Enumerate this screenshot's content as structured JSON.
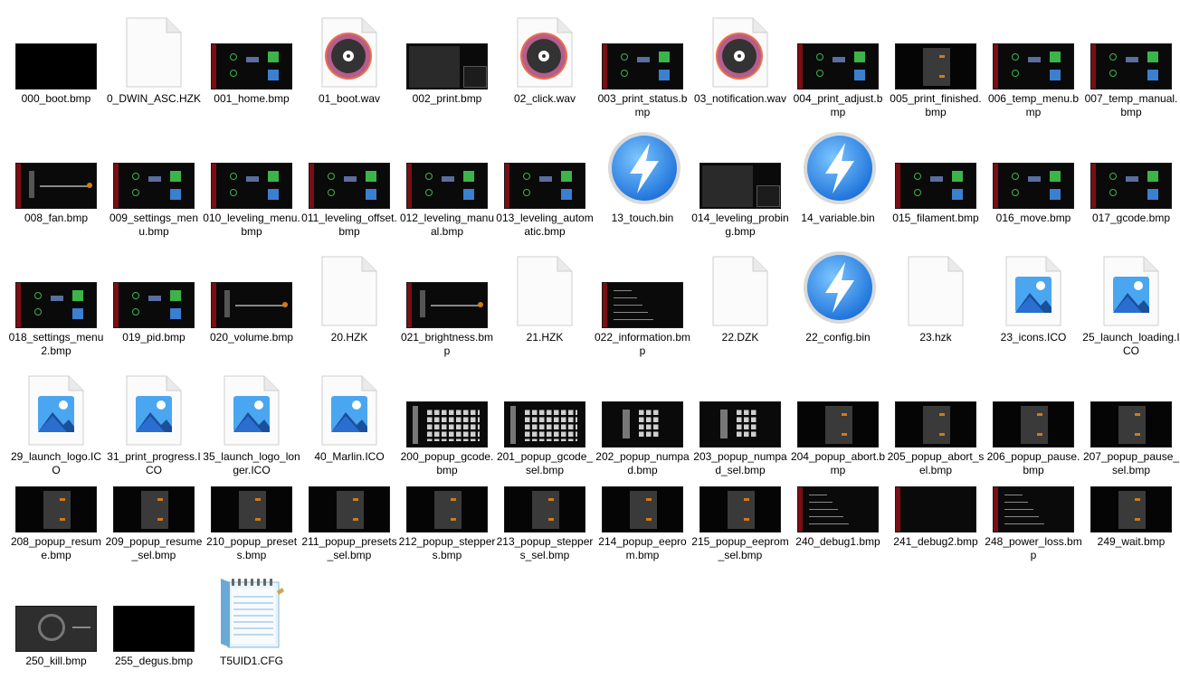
{
  "files": [
    {
      "name": "000_boot.bmp",
      "kind": "bmp",
      "style": "black"
    },
    {
      "name": "0_DWIN_ASC.HZK",
      "kind": "doc"
    },
    {
      "name": "001_home.bmp",
      "kind": "bmp",
      "style": "menu"
    },
    {
      "name": "01_boot.wav",
      "kind": "wav"
    },
    {
      "name": "002_print.bmp",
      "kind": "bmp",
      "style": "print"
    },
    {
      "name": "02_click.wav",
      "kind": "wav"
    },
    {
      "name": "003_print_status.bmp",
      "kind": "bmp",
      "style": "menu"
    },
    {
      "name": "03_notification.wav",
      "kind": "wav"
    },
    {
      "name": "004_print_adjust.bmp",
      "kind": "bmp",
      "style": "menu"
    },
    {
      "name": "005_print_finished.bmp",
      "kind": "bmp",
      "style": "popup"
    },
    {
      "name": "006_temp_menu.bmp",
      "kind": "bmp",
      "style": "menu"
    },
    {
      "name": "007_temp_manual.bmp",
      "kind": "bmp",
      "style": "menu"
    },
    {
      "name": "008_fan.bmp",
      "kind": "bmp",
      "style": "slider"
    },
    {
      "name": "009_settings_menu.bmp",
      "kind": "bmp",
      "style": "menu"
    },
    {
      "name": "010_leveling_menu.bmp",
      "kind": "bmp",
      "style": "menu"
    },
    {
      "name": "011_leveling_offset.bmp",
      "kind": "bmp",
      "style": "menu"
    },
    {
      "name": "012_leveling_manual.bmp",
      "kind": "bmp",
      "style": "menu"
    },
    {
      "name": "013_leveling_automatic.bmp",
      "kind": "bmp",
      "style": "menu"
    },
    {
      "name": "13_touch.bin",
      "kind": "bin"
    },
    {
      "name": "014_leveling_probing.bmp",
      "kind": "bmp",
      "style": "print"
    },
    {
      "name": "14_variable.bin",
      "kind": "bin"
    },
    {
      "name": "015_filament.bmp",
      "kind": "bmp",
      "style": "menu"
    },
    {
      "name": "016_move.bmp",
      "kind": "bmp",
      "style": "menu"
    },
    {
      "name": "017_gcode.bmp",
      "kind": "bmp",
      "style": "menu"
    },
    {
      "name": "018_settings_menu2.bmp",
      "kind": "bmp",
      "style": "menu"
    },
    {
      "name": "019_pid.bmp",
      "kind": "bmp",
      "style": "menu"
    },
    {
      "name": "020_volume.bmp",
      "kind": "bmp",
      "style": "slider"
    },
    {
      "name": "20.HZK",
      "kind": "doc"
    },
    {
      "name": "021_brightness.bmp",
      "kind": "bmp",
      "style": "slider"
    },
    {
      "name": "21.HZK",
      "kind": "doc"
    },
    {
      "name": "022_information.bmp",
      "kind": "bmp",
      "style": "info"
    },
    {
      "name": "22.DZK",
      "kind": "doc"
    },
    {
      "name": "22_config.bin",
      "kind": "bin"
    },
    {
      "name": "23.hzk",
      "kind": "doc"
    },
    {
      "name": "23_icons.ICO",
      "kind": "ico"
    },
    {
      "name": "25_launch_loading.ICO",
      "kind": "ico"
    },
    {
      "name": "29_launch_logo.ICO",
      "kind": "ico"
    },
    {
      "name": "31_print_progress.ICO",
      "kind": "ico"
    },
    {
      "name": "35_launch_logo_longer.ICO",
      "kind": "ico"
    },
    {
      "name": "40_Marlin.ICO",
      "kind": "ico"
    },
    {
      "name": "200_popup_gcode.bmp",
      "kind": "bmp",
      "style": "keys"
    },
    {
      "name": "201_popup_gcode_sel.bmp",
      "kind": "bmp",
      "style": "keys"
    },
    {
      "name": "202_popup_numpad.bmp",
      "kind": "bmp",
      "style": "numpad"
    },
    {
      "name": "203_popup_numpad_sel.bmp",
      "kind": "bmp",
      "style": "numpad"
    },
    {
      "name": "204_popup_abort.bmp",
      "kind": "bmp",
      "style": "popup"
    },
    {
      "name": "205_popup_abort_sel.bmp",
      "kind": "bmp",
      "style": "popup"
    },
    {
      "name": "206_popup_pause.bmp",
      "kind": "bmp",
      "style": "popup"
    },
    {
      "name": "207_popup_pause_sel.bmp",
      "kind": "bmp",
      "style": "popup"
    },
    {
      "name": "208_popup_resume.bmp",
      "kind": "bmp",
      "style": "popup"
    },
    {
      "name": "209_popup_resume_sel.bmp",
      "kind": "bmp",
      "style": "popup"
    },
    {
      "name": "210_popup_presets.bmp",
      "kind": "bmp",
      "style": "popup"
    },
    {
      "name": "211_popup_presets_sel.bmp",
      "kind": "bmp",
      "style": "popup"
    },
    {
      "name": "212_popup_steppers.bmp",
      "kind": "bmp",
      "style": "popup"
    },
    {
      "name": "213_popup_steppers_sel.bmp",
      "kind": "bmp",
      "style": "popup"
    },
    {
      "name": "214_popup_eeprom.bmp",
      "kind": "bmp",
      "style": "popup"
    },
    {
      "name": "215_popup_eeprom_sel.bmp",
      "kind": "bmp",
      "style": "popup"
    },
    {
      "name": "240_debug1.bmp",
      "kind": "bmp",
      "style": "info"
    },
    {
      "name": "241_debug2.bmp",
      "kind": "bmp",
      "style": "redbar"
    },
    {
      "name": "248_power_loss.bmp",
      "kind": "bmp",
      "style": "info"
    },
    {
      "name": "249_wait.bmp",
      "kind": "bmp",
      "style": "popup"
    },
    {
      "name": "250_kill.bmp",
      "kind": "bmp",
      "style": "kill"
    },
    {
      "name": "255_degus.bmp",
      "kind": "bmp",
      "style": "black"
    },
    {
      "name": "T5UID1.CFG",
      "kind": "cfg"
    }
  ]
}
